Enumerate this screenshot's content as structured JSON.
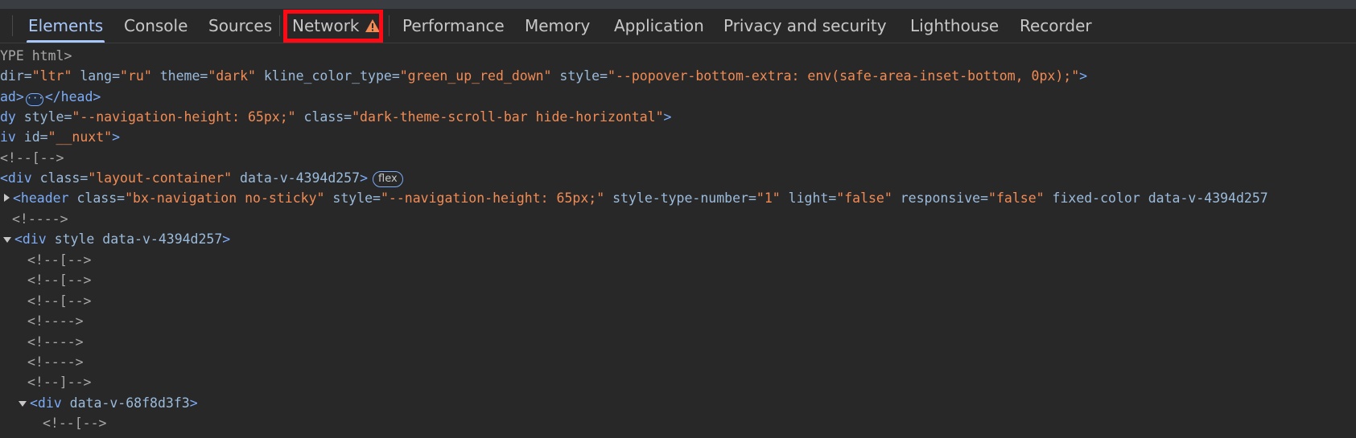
{
  "tabs": [
    {
      "label": "Elements",
      "active": true
    },
    {
      "label": "Console"
    },
    {
      "label": "Sources"
    },
    {
      "label": "Network",
      "warning": true
    },
    {
      "label": "Performance"
    },
    {
      "label": "Memory"
    },
    {
      "label": "Application"
    },
    {
      "label": "Privacy and security"
    },
    {
      "label": "Lighthouse"
    },
    {
      "label": "Recorder"
    }
  ],
  "colors": {
    "background": "#282828",
    "tag": "#7cacf8",
    "attr_name": "#9bbbdc",
    "attr_value": "#f28b54",
    "comment": "#a8a8a8",
    "active_tab": "#a8c7fa",
    "highlight": "#ff0a14",
    "warning": "#f28b54"
  },
  "tree": {
    "l0": "YPE html>",
    "l1": {
      "open": "dir=",
      "v1": "\"ltr\"",
      "a2": " lang=",
      "v2": "\"ru\"",
      "a3": " theme=",
      "v3": "\"dark\"",
      "a4": " kline_color_type=",
      "v4": "\"green_up_red_down\"",
      "a5": " style=",
      "v5": "\"--popover-bottom-extra: env(safe-area-inset-bottom, 0px);\"",
      "close": ">"
    },
    "l2": {
      "open": "ad>",
      "close": "</head>"
    },
    "l3": {
      "open": "dy",
      "a1": " style=",
      "v1": "\"--navigation-height: 65px;\"",
      "a2": " class=",
      "v2": "\"dark-theme-scroll-bar hide-horizontal\"",
      "close": ">"
    },
    "l4": {
      "open": "iv",
      "a1": " id=",
      "v1": "\"__nuxt\"",
      "close": ">"
    },
    "l5": "<!--[-->",
    "l6": {
      "open": "<div",
      "a1": " class=",
      "v1": "\"layout-container\"",
      "a2": " data-v-4394d257",
      "close": ">",
      "badge": "flex"
    },
    "l7": {
      "open": "<header",
      "a1": " class=",
      "v1": "\"bx-navigation no-sticky\"",
      "a2": " style=",
      "v2": "\"--navigation-height: 65px;\"",
      "a3": " style-type-number=",
      "v3": "\"1\"",
      "a4": " light=",
      "v4": "\"false\"",
      "a5": " responsive=",
      "v5": "\"false\"",
      "a6": " fixed-color data-v-4394d257"
    },
    "l8": "<!---->",
    "l9": {
      "open": "<div",
      "a1": " style data-v-4394d257",
      "close": ">"
    },
    "l10": "<!--[-->",
    "l11": "<!--[-->",
    "l12": "<!--[-->",
    "l13": "<!---->",
    "l14": "<!---->",
    "l15": "<!---->",
    "l16": "<!--]-->",
    "l17": {
      "open": "<div",
      "a1": " data-v-68f8d3f3",
      "close": ">"
    },
    "l18": "<!--[-->"
  }
}
